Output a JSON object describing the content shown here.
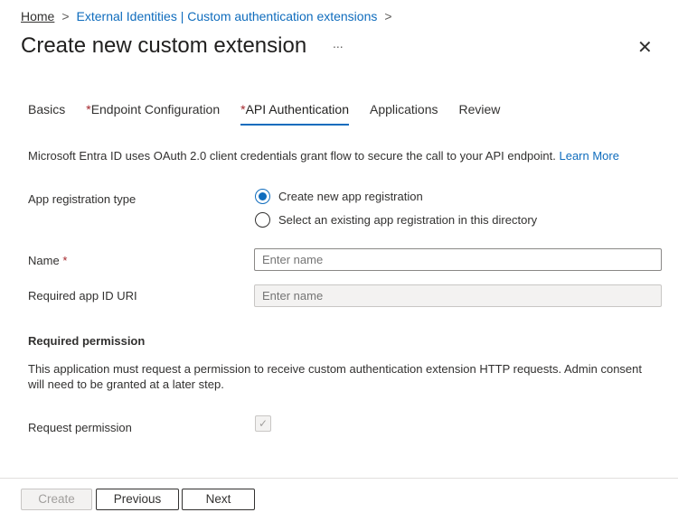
{
  "breadcrumb": {
    "home": "Home",
    "parent": "External Identities | Custom authentication extensions",
    "sep": ">"
  },
  "header": {
    "title": "Create new custom extension",
    "more": "...",
    "close": "✕"
  },
  "tabs": [
    {
      "label": "Basics",
      "required": false
    },
    {
      "label": "Endpoint Configuration",
      "required": true
    },
    {
      "label": "API Authentication",
      "required": true,
      "active": true
    },
    {
      "label": "Applications",
      "required": false
    },
    {
      "label": "Review",
      "required": false
    }
  ],
  "required_marker": "*",
  "description": {
    "text": "Microsoft Entra ID uses OAuth 2.0 client credentials grant flow to secure the call to your API endpoint.",
    "link": "Learn More"
  },
  "form": {
    "app_reg_label": "App registration type",
    "app_reg_options": [
      {
        "label": "Create new app registration",
        "selected": true
      },
      {
        "label": "Select an existing app registration in this directory",
        "selected": false
      }
    ],
    "name_label": "Name",
    "name_placeholder": "Enter name",
    "name_value": "",
    "uri_label": "Required app ID URI",
    "uri_placeholder": "Enter name"
  },
  "permission": {
    "heading": "Required permission",
    "text": "This application must request a permission to receive custom authentication extension HTTP requests. Admin consent will need to be granted at a later step.",
    "label": "Request permission",
    "checked": true,
    "check": "✓"
  },
  "footer": {
    "create": "Create",
    "previous": "Previous",
    "next": "Next"
  }
}
